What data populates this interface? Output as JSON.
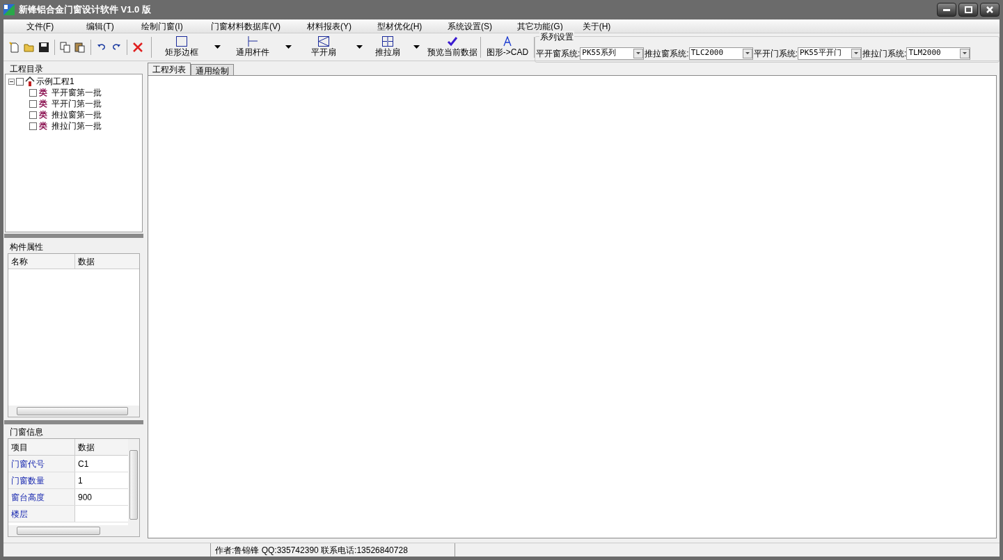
{
  "window": {
    "title": "新锋铝合金门窗设计软件 V1.0 版"
  },
  "menu": [
    "文件(F)",
    "编辑(T)",
    "绘制门窗(I)",
    "门窗材料数据库(V)",
    "材料报表(Y)",
    "型材优化(H)",
    "系统设置(S)",
    "其它功能(G)",
    "关于(H)"
  ],
  "toolbar": [
    {
      "label": "矩形边框",
      "has_dropdown": true
    },
    {
      "label": "通用杆件",
      "has_dropdown": true
    },
    {
      "label": "平开扇",
      "has_dropdown": true
    },
    {
      "label": "推拉扇",
      "has_dropdown": true
    },
    {
      "label": "预览当前数据",
      "has_dropdown": false
    },
    {
      "label": "图形->CAD",
      "has_dropdown": false
    }
  ],
  "series": {
    "title": "系列设置",
    "selectors": [
      {
        "label": "平开窗系统:",
        "value": "PK55系列"
      },
      {
        "label": "推拉窗系统:",
        "value": "TLC2000"
      },
      {
        "label": "平开门系统:",
        "value": "PK55平开门"
      },
      {
        "label": "推拉门系统:",
        "value": "TLM2000"
      }
    ]
  },
  "project_tree": {
    "title": "工程目录",
    "root": {
      "label": "示例工程1",
      "checked": false,
      "expanded": true,
      "children": [
        {
          "tag": "类",
          "label": "平开窗第一批",
          "checked": false
        },
        {
          "tag": "类",
          "label": "平开门第一批",
          "checked": false
        },
        {
          "tag": "类",
          "label": "推拉窗第一批",
          "checked": false
        },
        {
          "tag": "类",
          "label": "推拉门第一批",
          "checked": false
        }
      ]
    }
  },
  "component_properties": {
    "title": "构件属性",
    "columns": [
      "名称",
      "数据"
    ]
  },
  "window_info": {
    "title": "门窗信息",
    "columns": [
      "项目",
      "数据"
    ],
    "rows": [
      {
        "name": "门窗代号",
        "value": "C1"
      },
      {
        "name": "门窗数量",
        "value": "1"
      },
      {
        "name": "窗台高度",
        "value": "900"
      },
      {
        "name": "楼层",
        "value": ""
      }
    ]
  },
  "tabs": [
    {
      "label": "工程列表",
      "selected": true
    },
    {
      "label": "通用绘制",
      "selected": false
    }
  ],
  "status_bar": {
    "text": "作者:鲁锦锋  QQ:335742390  联系电话:13526840728"
  }
}
